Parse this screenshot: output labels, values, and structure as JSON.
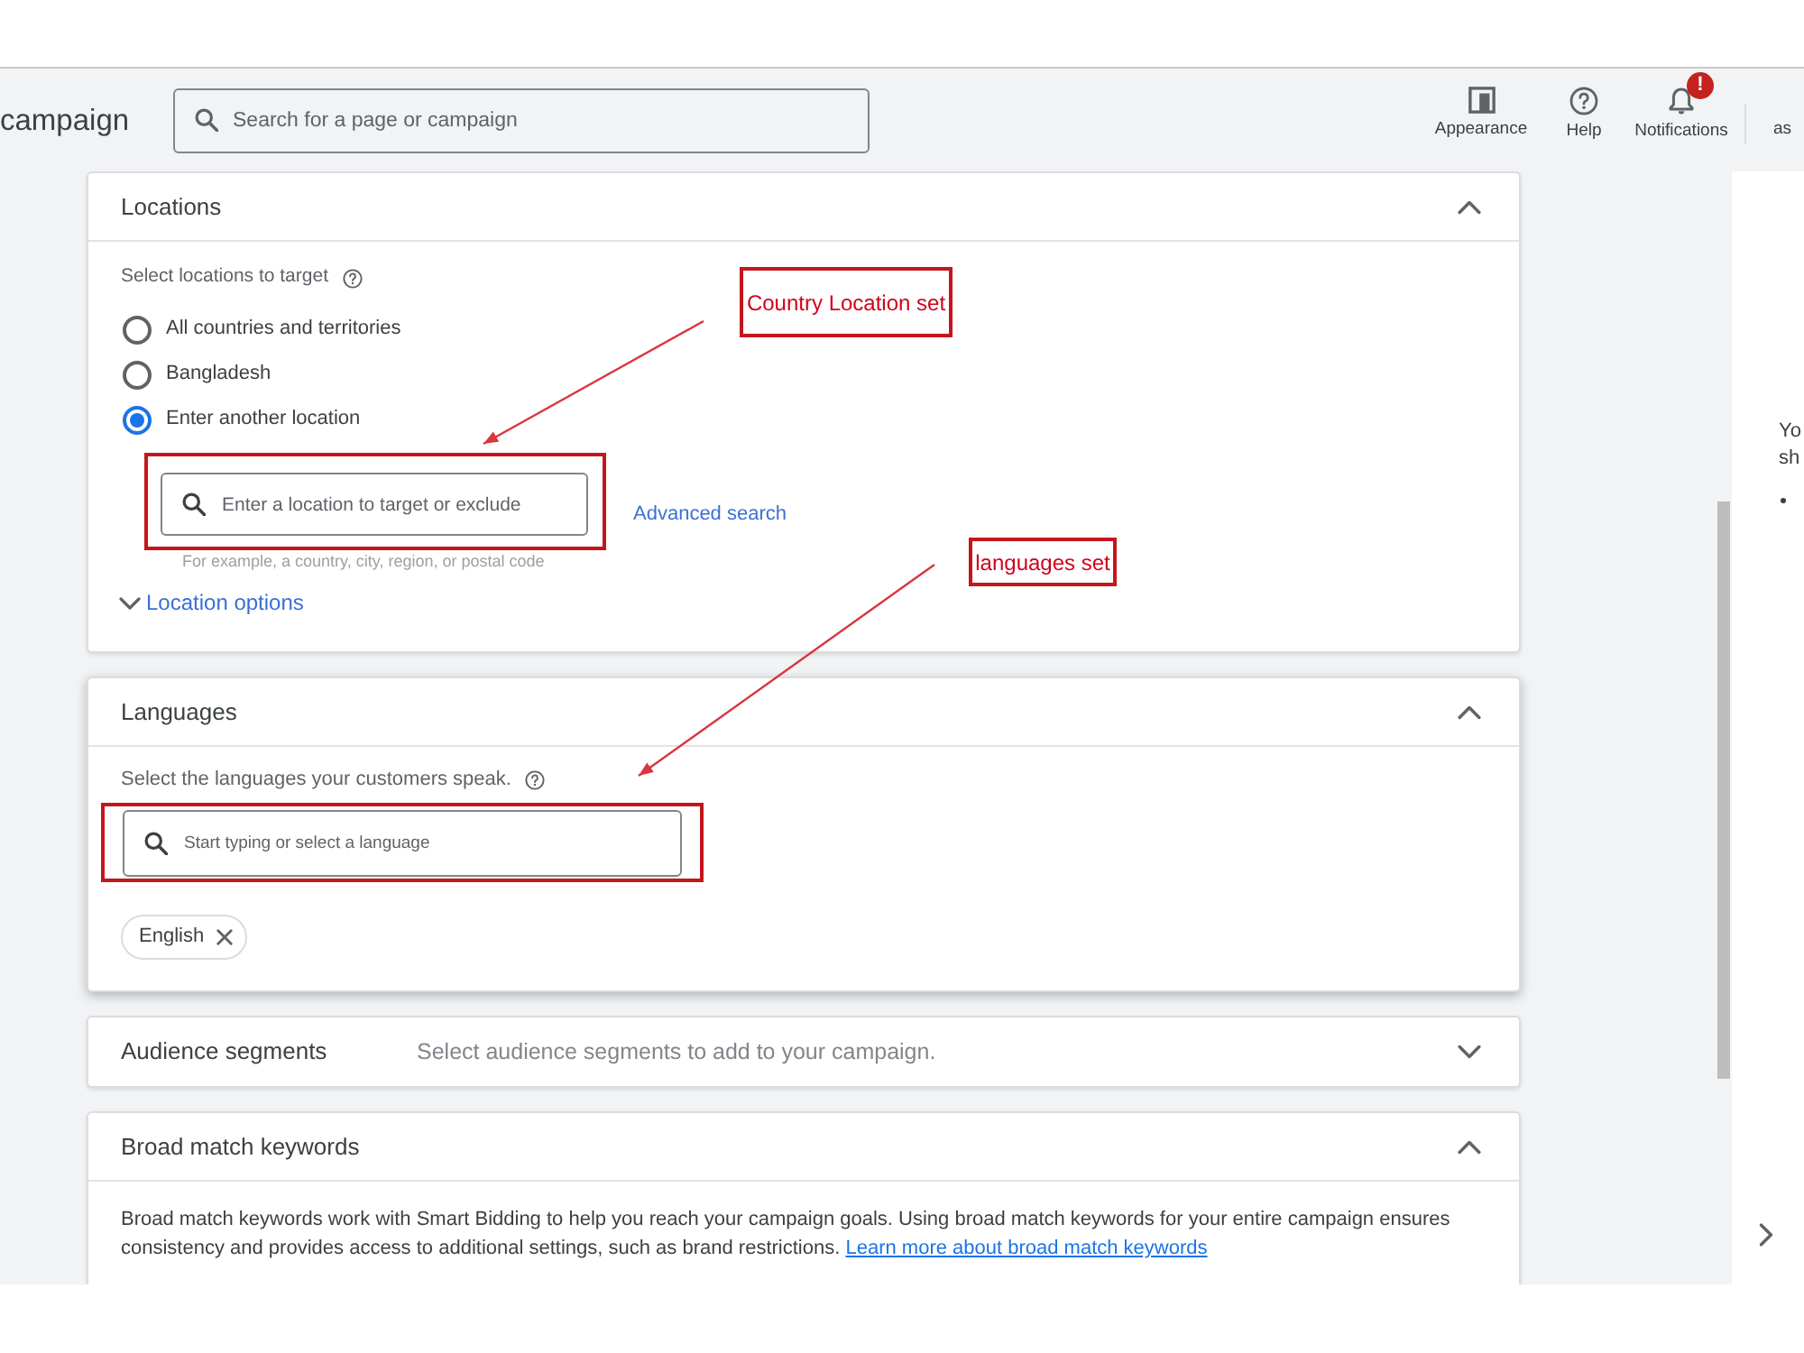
{
  "header": {
    "title": "campaign",
    "search": {
      "placeholder": "Search for a page or campaign"
    },
    "actions": [
      {
        "kind": "appearance",
        "label": "Appearance"
      },
      {
        "kind": "help",
        "label": "Help"
      },
      {
        "kind": "notifications",
        "label": "Notifications",
        "badge": "!"
      }
    ],
    "account": "as"
  },
  "sections": [
    {
      "kind": "locations",
      "title": "Locations",
      "expanded": true,
      "prompt": "Select locations to target",
      "options": [
        {
          "label": "All countries and territories",
          "selected": false
        },
        {
          "label": "Bangladesh",
          "selected": false
        },
        {
          "label": "Enter another location",
          "selected": true
        }
      ],
      "search": {
        "placeholder": "Enter a location to target or exclude"
      },
      "hint": "For example, a country, city, region, or postal code",
      "advanced_link": "Advanced search",
      "options_link": "Location options"
    },
    {
      "kind": "languages",
      "title": "Languages",
      "expanded": true,
      "prompt": "Select the languages your customers speak.",
      "search": {
        "placeholder": "Start typing or select a language"
      },
      "chips": [
        {
          "label": "English"
        }
      ]
    },
    {
      "kind": "audience",
      "title": "Audience segments",
      "expanded": false,
      "summary": "Select audience segments to add to your campaign."
    },
    {
      "kind": "broad_match",
      "title": "Broad match keywords",
      "expanded": true,
      "description": "Broad match keywords work with Smart Bidding to help you reach your campaign goals. Using broad match keywords for your entire campaign ensures consistency and provides access to additional settings, such as brand restrictions.",
      "link": "Learn more about broad match keywords"
    }
  ],
  "side_panel": {
    "lines": [
      "Yo",
      "sh"
    ],
    "bullet": true
  },
  "annotations": [
    {
      "kind": "location",
      "label": "Country Location set"
    },
    {
      "kind": "language",
      "label": "languages set"
    }
  ]
}
